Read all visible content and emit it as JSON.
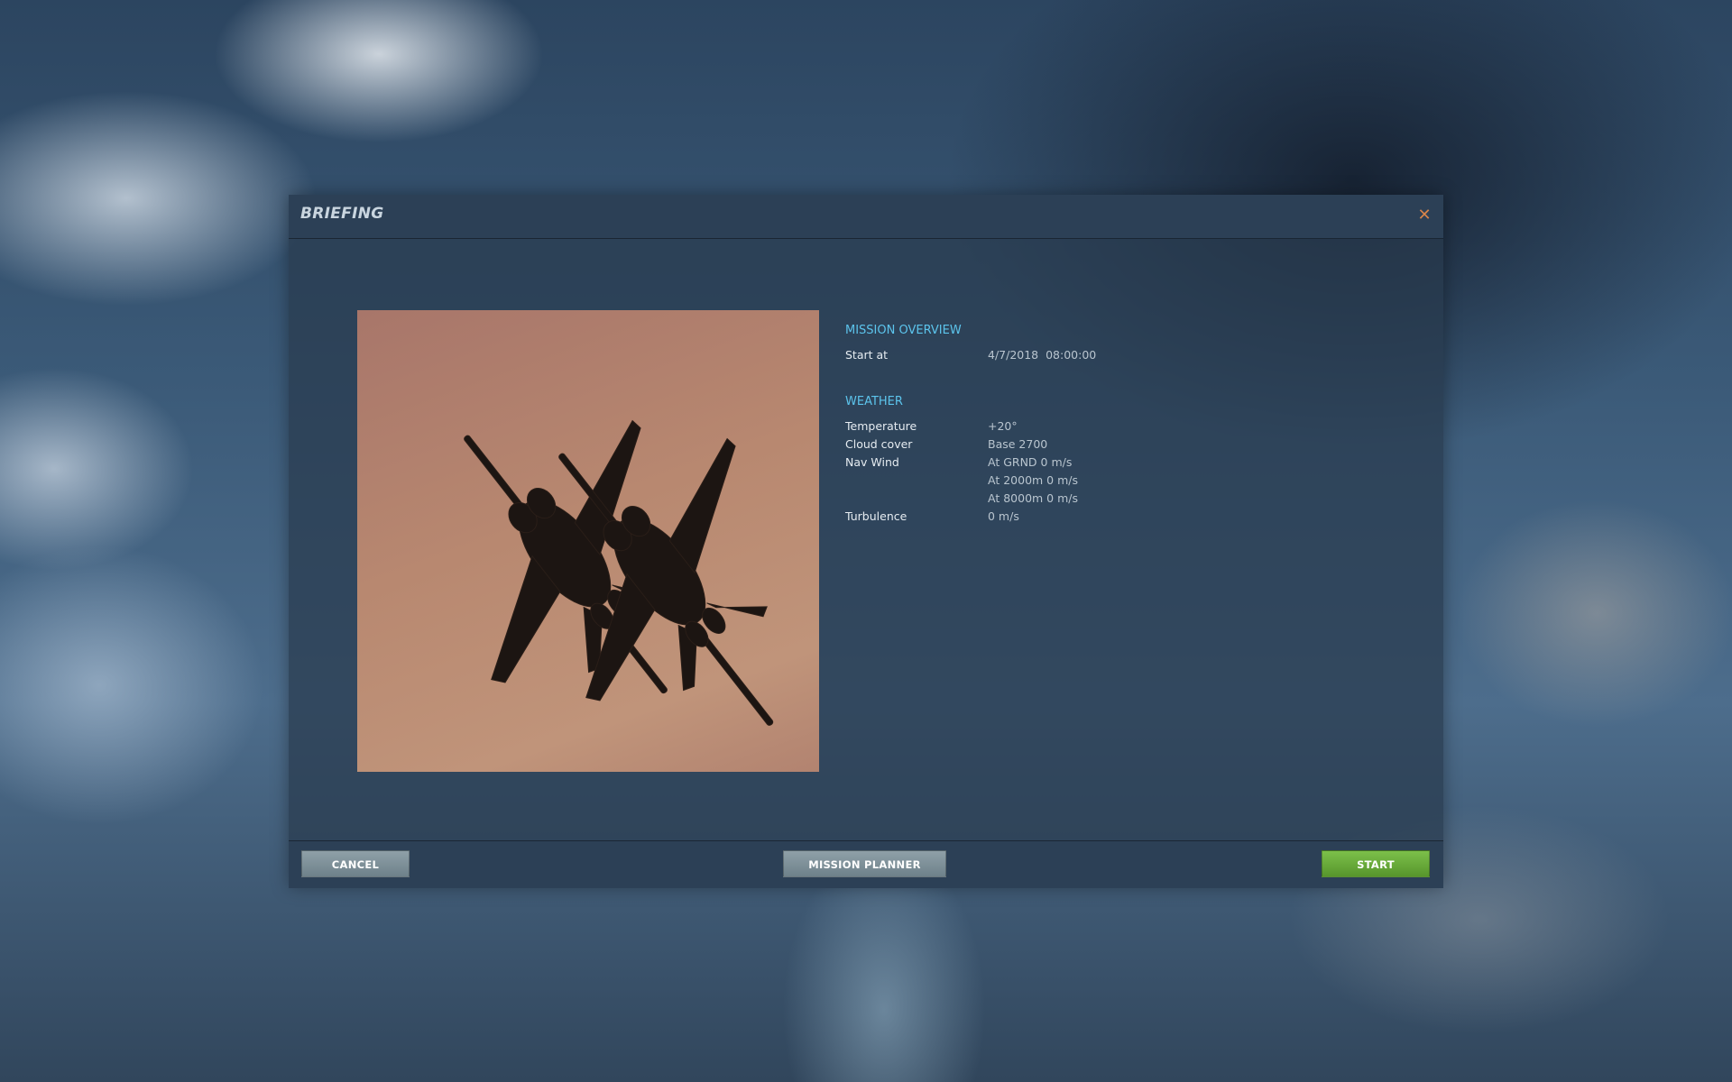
{
  "dialog": {
    "title": "BRIEFING",
    "close_icon": "close-icon"
  },
  "picture": {
    "icon": "aircraft-image"
  },
  "mission_overview": {
    "heading": "MISSION OVERVIEW",
    "rows": [
      {
        "label": "Start at",
        "value": "4/7/2018  08:00:00"
      }
    ]
  },
  "weather": {
    "heading": "WEATHER",
    "temperature_label": "Temperature",
    "temperature_value": "+20°",
    "cloud_label": "Cloud cover",
    "cloud_value": "Base 2700",
    "wind_label": "Nav Wind",
    "wind_values": [
      "At GRND 0 m/s",
      "At 2000m 0 m/s",
      "At 8000m 0 m/s"
    ],
    "turbulence_label": "Turbulence",
    "turbulence_value": "0 m/s"
  },
  "footer": {
    "cancel_label": "CANCEL",
    "planner_label": "MISSION PLANNER",
    "start_label": "START"
  },
  "colors": {
    "accent": "#5cc4ec",
    "start_button": "#6aab3a",
    "close_icon": "#d7844a"
  }
}
